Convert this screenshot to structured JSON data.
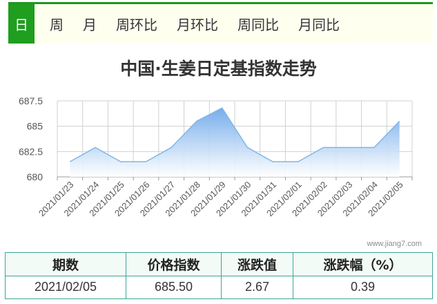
{
  "tabs": [
    {
      "label": "日",
      "active": true
    },
    {
      "label": "周",
      "active": false
    },
    {
      "label": "月",
      "active": false
    },
    {
      "label": "周环比",
      "active": false
    },
    {
      "label": "月环比",
      "active": false
    },
    {
      "label": "周同比",
      "active": false
    },
    {
      "label": "月同比",
      "active": false
    }
  ],
  "chart_title": "中国·生姜日定基指数走势",
  "watermark": "www.jiang7.com",
  "colors": {
    "accent": "#1f9e1f",
    "line": "#7fb6e8",
    "area_top": "#7ab1ea",
    "table_border": "#3aa59a"
  },
  "chart_data": {
    "type": "area",
    "title": "中国·生姜日定基指数走势",
    "categories": [
      "2021/01/23",
      "2021/01/24",
      "2021/01/25",
      "2021/01/26",
      "2021/01/27",
      "2021/01/28",
      "2021/01/29",
      "2021/01/30",
      "2021/01/31",
      "2021/02/01",
      "2021/02/02",
      "2021/02/03",
      "2021/02/04",
      "2021/02/05"
    ],
    "values": [
      681.5,
      682.9,
      681.5,
      681.5,
      682.9,
      685.5,
      686.8,
      682.9,
      681.5,
      681.5,
      682.9,
      682.9,
      682.9,
      685.5
    ],
    "y_ticks": [
      "687.5",
      "685",
      "682.5",
      "680"
    ],
    "ylim": [
      680,
      687.5
    ],
    "grid": true,
    "xlabel": "",
    "ylabel": ""
  },
  "table": {
    "headers": [
      "期数",
      "价格指数",
      "涨跌值",
      "涨跌幅（%）"
    ],
    "row": [
      "2021/02/05",
      "685.50",
      "2.67",
      "0.39"
    ]
  }
}
